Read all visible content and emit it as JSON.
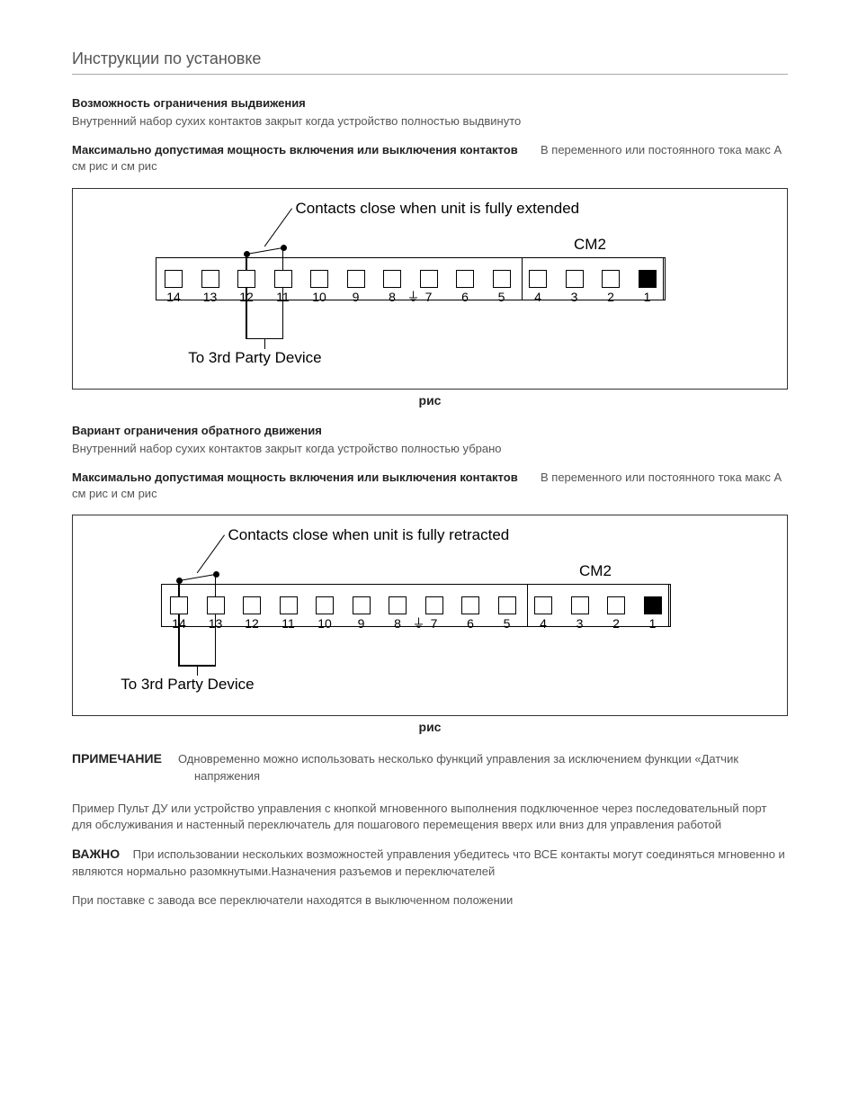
{
  "page_title": "Инструкции по установке",
  "section1": {
    "heading": "Возможность ограничения выдвижения",
    "desc": "Внутренний набор сухих контактов закрыт  когда устройство полностью выдвинуто",
    "rating_lead": "Максимально допустимая мощность включения или выключения контактов",
    "rating_tail": "В переменного или постоянного тока макс     А   см  рис        и см  рис"
  },
  "fig1": {
    "top_label": "Contacts close when unit is fully extended",
    "bottom_label": "To 3rd Party Device",
    "cm2": "CM2",
    "caption": "рис",
    "terminals": [
      "14",
      "13",
      "12",
      "11",
      "10",
      "9",
      "8",
      "7",
      "6",
      "5",
      "4",
      "3",
      "2",
      "1"
    ],
    "gnd_index": 7,
    "bridge": [
      2,
      3
    ],
    "leaders": [
      2,
      3
    ]
  },
  "section2": {
    "heading": "Вариант ограничения обратного движения",
    "desc": "Внутренний набор сухих контактов закрыт  когда устройство полностью убрано",
    "rating_lead": "Максимально допустимая мощность включения или выключения контактов",
    "rating_tail": "В переменного или постоянного тока макс     А   см  рис        и см  рис"
  },
  "fig2": {
    "top_label": "Contacts close when unit is fully retracted",
    "bottom_label": "To 3rd Party Device",
    "cm2": "CM2",
    "caption": "рис",
    "terminals": [
      "14",
      "13",
      "12",
      "11",
      "10",
      "9",
      "8",
      "7",
      "6",
      "5",
      "4",
      "3",
      "2",
      "1"
    ],
    "gnd_index": 7,
    "bridge": [
      0,
      1
    ],
    "leaders": [
      0,
      1
    ]
  },
  "note_label": "ПРИМЕЧАНИЕ",
  "note_text": "Одновременно можно использовать несколько функций управления  за исключением функции «Датчик напряжения",
  "example_text": "Пример  Пульт ДУ или устройство управления с кнопкой мгновенного выполнения  подключенное через последовательный порт  для обслуживания и настенный переключатель для пошагового перемещения вверх или вниз для управления работой",
  "important_label": "ВАЖНО",
  "important_text": "При использовании нескольких возможностей управления убедитесь  что ВСЕ контакты могут соединяться мгновенно и являются нормально разомкнутыми.Назначения разъемов и переключателей",
  "factory_text": "При поставке с завода все        переключатели находятся в выключенном положении"
}
